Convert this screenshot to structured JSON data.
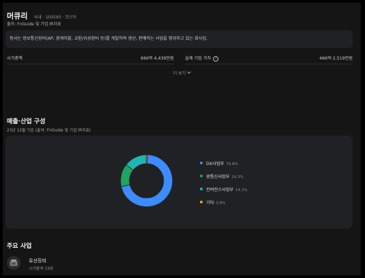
{
  "company": {
    "name": "머큐리",
    "meta": "사내 · 100590 · 코스닥",
    "source": "출처: FnGuide 및 기업 IR자료",
    "description": "동사는 정보통신장비(AP, 광케이블, 교환/위성장비 등)를 개발하여 생산, 판매하는 사업을 영위하고 있는 회사임."
  },
  "metrics": {
    "market_cap_label": "시가총액",
    "market_cap_value": "666억 4,439만원",
    "enterprise_value_label": "실제 기업 가치",
    "enterprise_value_value": "466억 2,519만원",
    "info_icon": "info-icon"
  },
  "more_label": "더 보기",
  "revenue_section": {
    "title": "매출·산업 구성",
    "subtitle": "23년 12월 기준 (출처: FnGuide 및 기업 IR자료)"
  },
  "chart_data": {
    "type": "pie",
    "categories": [
      "DX사업부",
      "광통신사업부",
      "컨버전스사업부",
      "기타"
    ],
    "values": [
      70.8,
      14.3,
      14.2,
      0.8
    ],
    "value_labels": [
      "70.8%",
      "14.3%",
      "14.2%",
      "0.8%"
    ],
    "colors": [
      "#3d8bfd",
      "#1fa463",
      "#22b3b3",
      "#f0a030"
    ],
    "legend_position": "right",
    "donut": true
  },
  "main_business": {
    "title": "주요 사업",
    "items": [
      {
        "name": "유선장비",
        "rank": "시가총액 33위",
        "icon": "telephone-icon"
      }
    ]
  }
}
